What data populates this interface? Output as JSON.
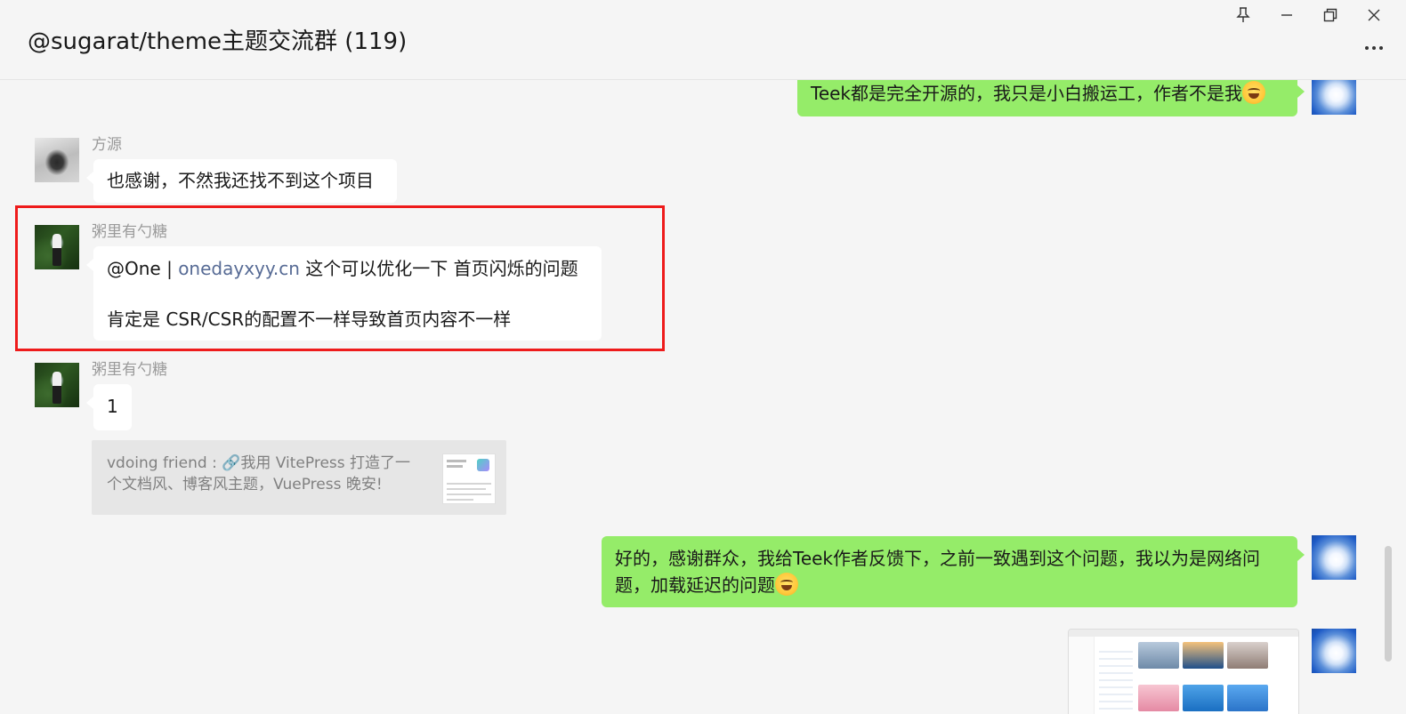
{
  "window": {
    "title": "@sugarat/theme主题交流群 (119)",
    "controls": [
      "pin-icon",
      "minimize-icon",
      "restore-icon",
      "close-icon",
      "more-icon"
    ]
  },
  "messages": [
    {
      "direction": "out",
      "text": "Teek都是完全开源的，我只是小白搬运工，作者不是我",
      "emoji": "laughing-tears-emoji"
    },
    {
      "direction": "in",
      "sender": "方源",
      "text": "也感谢，不然我还找不到这个项目"
    },
    {
      "direction": "in",
      "sender": "粥里有勺糖",
      "mention": "@One | ",
      "link": "onedayxyy.cn",
      "line1_rest": " 这个可以优化一下 首页闪烁的问题",
      "line2": "肯定是 CSR/CSR的配置不一样导致首页内容不一样",
      "highlighted": true
    },
    {
      "direction": "in",
      "sender": "粥里有勺糖",
      "text": "1",
      "quote": "vdoing friend : 🔗我用 VitePress 打造了一个文档风、博客风主题，VuePress 晚安!"
    },
    {
      "direction": "out",
      "text": "好的，感谢群众，我给Teek作者反馈下，之前一致遇到这个问题，我以为是网络问题，加载延迟的问题",
      "emoji": "crying-laughing-emoji"
    },
    {
      "direction": "out",
      "type": "image",
      "image": "browser-screenshot-thumbnail"
    }
  ],
  "colors": {
    "background": "#f5f5f5",
    "out_bubble": "#95ec69",
    "in_bubble": "#ffffff",
    "link": "#576b95",
    "highlight_box": "#ee1b1b",
    "sender_name": "#9a9a9a"
  }
}
